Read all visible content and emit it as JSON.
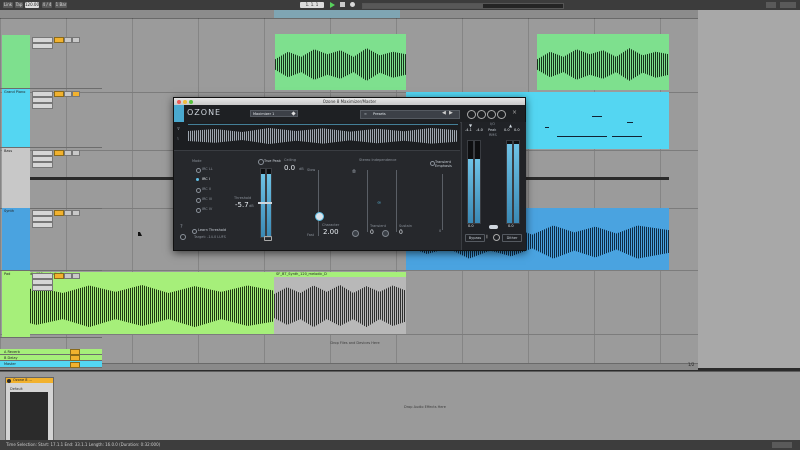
{
  "transport": {
    "link_label": "Link",
    "tap_label": "Tap",
    "tempo": "120.00",
    "time_sig": "4 / 4",
    "quantize": "1 Bar",
    "position": "1. 1. 1"
  },
  "colors": {
    "green_clip": "#7ee08e",
    "cyan_clip": "#54d6f2",
    "blue_clip": "#4aa3e0",
    "light_green_clip": "#a6ef7a",
    "grey_clip": "#b8b8b8",
    "ozone_accent": "#5fc0e6"
  },
  "tracks": [
    {
      "name": "",
      "color": "#7ee08e"
    },
    {
      "name": "Grand Piano",
      "color": "#54d6f2"
    },
    {
      "name": "Bass",
      "color": "#c8c8c8"
    },
    {
      "name": "Synth",
      "color": "#4aa3e0"
    },
    {
      "name": "Pad",
      "color": "#a6ef7a"
    }
  ],
  "returns": [
    {
      "name": "A Reverb"
    },
    {
      "name": "B Delay"
    },
    {
      "name": "Master"
    }
  ],
  "clips": {
    "pad_clip_title": "SF_BT_Synth_120_melodic_D",
    "pad_clip_title2": "SF_BT_Synth_120_melodic_D"
  },
  "arrangement": {
    "drop_hint": "Drop Files and Devices Here",
    "page_indicator": "1/2"
  },
  "device_panel": {
    "device_title": "Ozone 8 ...",
    "device_preset": "Default",
    "drop_hint": "Drop Audio Effects Here"
  },
  "status": {
    "selection": "Time Selection:  Start: 17.1.1  End: 33.1.1  Length: 16.0.0  (Duration: 0:32:000)"
  },
  "ozone": {
    "window_title": "Ozone 8 Maximizer/Master",
    "logo": "OZONE",
    "module_name": "Maximizer 1",
    "presets_label": "Presets",
    "threshold_label": "Threshold",
    "threshold_value": "-5.7",
    "threshold_unit": "dB",
    "true_peak_label": "True Peak",
    "ceiling_label": "Ceiling",
    "ceiling_value": "0.0",
    "ceiling_unit": "dB",
    "character_label": "Character",
    "character_value": "2.00",
    "fast_label": "Fast",
    "slow_label": "Slow",
    "stereo_label": "Stereo Independence",
    "transient_label": "Transient",
    "sustain_label": "Sustain",
    "transient_value": "0",
    "sustain_value": "0",
    "transient_emphasis_label": "Transient Emphasis",
    "transient_emphasis_value": "0",
    "mode_label": "Mode",
    "modes": [
      "IRC LL",
      "IRC I",
      "IRC II",
      "IRC III",
      "IRC IV"
    ],
    "learn_label": "Learn Threshold",
    "target_label": "Target: -14.0 LUFS",
    "io_labels": [
      "I/O",
      "Peak",
      "RMS"
    ],
    "in_peak": "-4.1",
    "in_peak2": "-4.0",
    "out_peak": "0.0",
    "out_peak2": "0.0",
    "in_gain": "0.0",
    "out_gain": "0.0",
    "bypass_label": "Bypass",
    "dither_label": "Dither"
  }
}
